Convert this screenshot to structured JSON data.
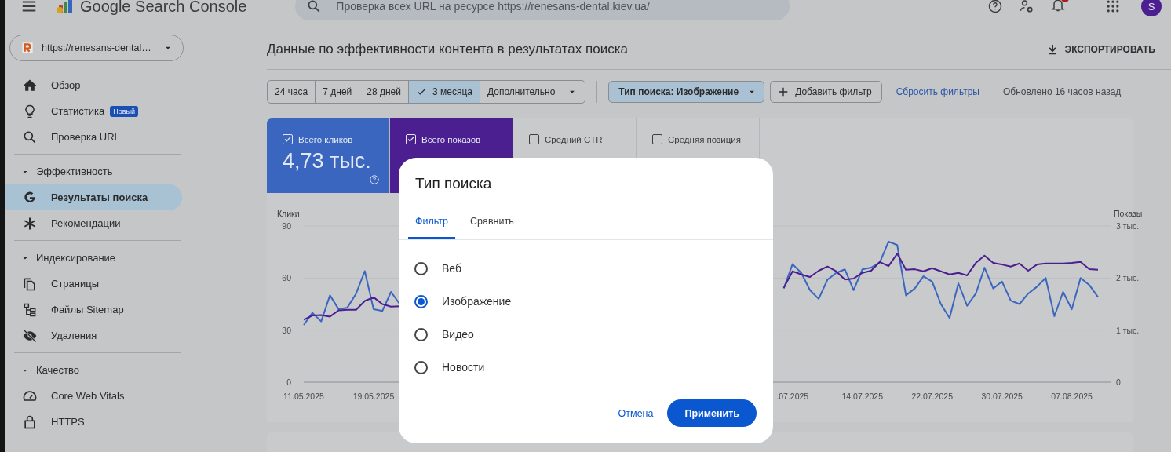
{
  "topbar": {
    "app_name": "Google Search Console",
    "search_placeholder": "Проверка всех URL на ресурсе https://renesans-dental.kiev.ua/",
    "avatar_letter": "S"
  },
  "sidebar": {
    "property": "https://renesans-dental…",
    "top_items": [
      {
        "label": "Обзор",
        "selected": false
      },
      {
        "label": "Статистика",
        "badge": "Новый",
        "selected": false
      },
      {
        "label": "Проверка URL",
        "selected": false
      }
    ],
    "sections": [
      {
        "title": "Эффективность",
        "expanded": true,
        "items": [
          {
            "label": "Результаты поиска",
            "selected": true
          },
          {
            "label": "Рекомендации",
            "selected": false
          }
        ]
      },
      {
        "title": "Индексирование",
        "expanded": true,
        "items": [
          {
            "label": "Страницы",
            "selected": false
          },
          {
            "label": "Файлы Sitemap",
            "selected": false
          },
          {
            "label": "Удаления",
            "selected": false
          }
        ]
      },
      {
        "title": "Качество",
        "expanded": true,
        "items": [
          {
            "label": "Core Web Vitals",
            "selected": false
          },
          {
            "label": "HTTPS",
            "selected": false
          }
        ]
      }
    ]
  },
  "page": {
    "title": "Данные по эффективности контента в результатах поиска",
    "export_label": "ЭКСПОРТИРОВАТЬ"
  },
  "filters": {
    "ranges": [
      {
        "label": "24 часа",
        "kind": "option",
        "selected": false
      },
      {
        "label": "7 дней",
        "kind": "option",
        "selected": false
      },
      {
        "label": "28 дней",
        "kind": "option",
        "selected": false
      },
      {
        "label": "3 месяца",
        "kind": "option",
        "selected": true
      },
      {
        "label": "Дополнительно",
        "kind": "dropdown",
        "selected": false
      }
    ],
    "search_type_chip": "Тип поиска: Изображение",
    "add_filter": "Добавить фильтр",
    "reset_link": "Сбросить фильтры",
    "updated": "Обновлено 16 часов назад"
  },
  "metrics": [
    {
      "label": "Всего кликов",
      "checked": true,
      "color": "#3b66c0",
      "value": "4,73 тыс."
    },
    {
      "label": "Всего показов",
      "checked": true,
      "color": "#4b1f90"
    },
    {
      "label": "Средний CTR",
      "checked": false
    },
    {
      "label": "Средняя позиция",
      "checked": false
    }
  ],
  "chart_data": {
    "type": "line",
    "ylabel": "Клики",
    "y2label": "Показы",
    "ylim": [
      0,
      90
    ],
    "yticks": [
      0,
      30,
      60,
      90
    ],
    "y2lim": [
      0,
      3
    ],
    "y2ticks": [
      0,
      {
        "value": 1,
        "label": "1 тыс."
      },
      {
        "value": 2,
        "label": "2 тыс."
      },
      {
        "value": 3,
        "label": "3 тыс."
      }
    ],
    "categories": [
      "11.05.2025",
      null,
      null,
      null,
      null,
      null,
      null,
      null,
      "19.05.2025",
      null,
      null,
      null,
      null,
      null,
      null,
      null,
      null,
      null,
      null,
      null,
      null,
      null,
      null,
      null,
      null,
      null,
      null,
      null,
      null,
      null,
      null,
      null,
      null,
      null,
      null,
      null,
      null,
      null,
      null,
      null,
      null,
      null,
      null,
      null,
      null,
      null,
      null,
      null,
      null,
      null,
      null,
      null,
      null,
      null,
      null,
      null,
      ".07.2025",
      null,
      null,
      null,
      null,
      null,
      null,
      null,
      "14.07.2025",
      null,
      null,
      null,
      null,
      null,
      null,
      null,
      "22.07.2025",
      null,
      null,
      null,
      null,
      null,
      null,
      null,
      "30.07.2025",
      null,
      null,
      null,
      null,
      null,
      null,
      null,
      "07.08.2025",
      null,
      null,
      null
    ],
    "series": [
      {
        "color": "#3b66c0",
        "values": [
          33,
          40,
          35,
          50,
          42,
          43,
          51,
          64,
          42,
          41,
          52,
          45,
          null,
          null,
          null,
          null,
          null,
          null,
          null,
          null,
          null,
          null,
          null,
          null,
          null,
          null,
          null,
          null,
          null,
          null,
          null,
          null,
          null,
          null,
          null,
          null,
          null,
          null,
          null,
          null,
          null,
          null,
          null,
          null,
          null,
          null,
          null,
          null,
          null,
          null,
          null,
          null,
          null,
          null,
          null,
          54,
          68,
          63,
          53,
          48,
          59,
          63,
          65,
          53,
          65,
          66,
          69,
          81,
          79,
          50,
          54,
          61,
          58,
          45,
          37,
          57,
          44,
          51,
          66,
          54,
          58,
          47,
          45,
          51,
          55,
          60,
          38,
          52,
          42,
          60,
          56,
          49
        ]
      },
      {
        "color": "#4b1f90",
        "axis": "y2",
        "values": [
          1.2,
          1.28,
          1.29,
          1.26,
          1.38,
          1.39,
          1.39,
          1.56,
          1.63,
          1.5,
          1.45,
          1.46,
          null,
          null,
          null,
          null,
          null,
          null,
          null,
          null,
          null,
          null,
          null,
          null,
          null,
          null,
          null,
          null,
          null,
          null,
          null,
          null,
          null,
          null,
          null,
          null,
          null,
          null,
          null,
          null,
          null,
          null,
          null,
          null,
          null,
          null,
          null,
          null,
          null,
          null,
          null,
          null,
          null,
          null,
          null,
          1.81,
          2.13,
          2.07,
          2.02,
          2.14,
          2.22,
          2.13,
          1.97,
          1.99,
          2.1,
          2.14,
          2.31,
          2.23,
          2.47,
          2.16,
          2.17,
          2.13,
          2.19,
          2.13,
          2.07,
          2.1,
          2.05,
          2.29,
          2.43,
          2.29,
          2.26,
          2.22,
          2.28,
          2.14,
          2.26,
          2.28,
          2.28,
          2.28,
          2.29,
          2.31,
          2.17,
          2.16
        ]
      }
    ]
  },
  "dialog": {
    "title": "Тип поиска",
    "tabs": [
      {
        "label": "Фильтр",
        "selected": true
      },
      {
        "label": "Сравнить",
        "selected": false
      }
    ],
    "options": [
      {
        "label": "Веб",
        "selected": false
      },
      {
        "label": "Изображение",
        "selected": true
      },
      {
        "label": "Видео",
        "selected": false
      },
      {
        "label": "Новости",
        "selected": false
      }
    ],
    "cancel": "Отмена",
    "apply": "Применить"
  }
}
